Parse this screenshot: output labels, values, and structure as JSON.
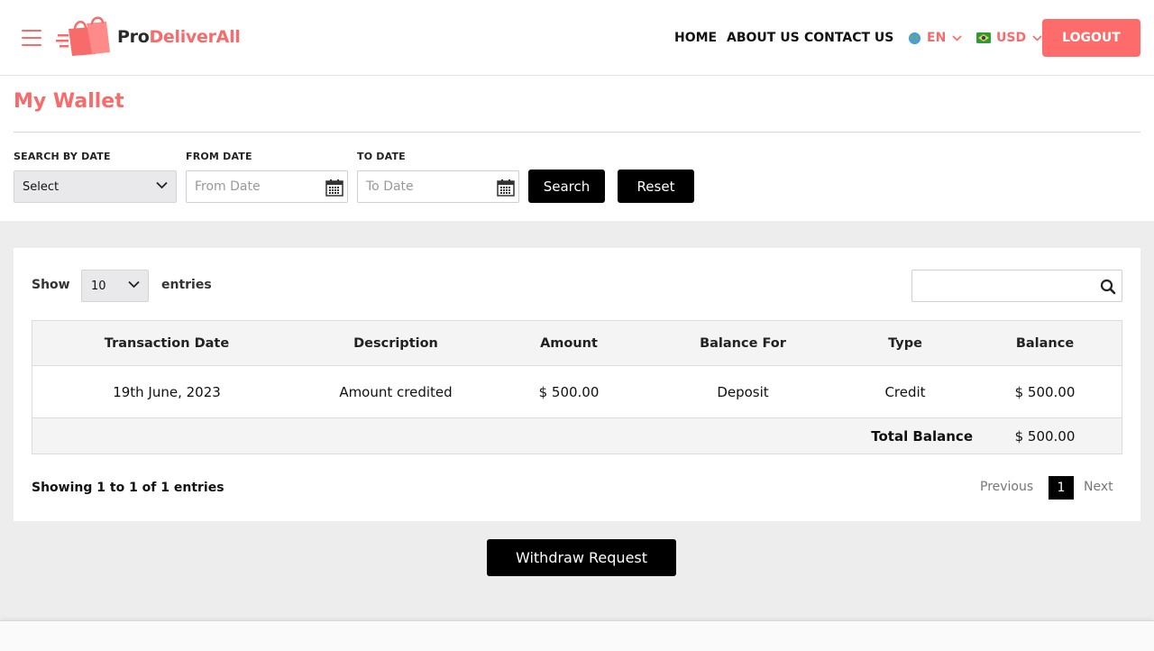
{
  "brand": {
    "part1": "Pro",
    "part2": "DeliverAll",
    "accent_color": "#f76b6b"
  },
  "nav": {
    "home": "HOME",
    "about": "ABOUT US",
    "contact": "CONTACT US",
    "language": "EN",
    "currency": "USD",
    "logout": "LOGOUT"
  },
  "page": {
    "title": "My Wallet"
  },
  "filters": {
    "search_by_date_label": "SEARCH BY DATE",
    "search_by_date_value": "Select",
    "from_date_label": "FROM DATE",
    "from_date_placeholder": "From Date",
    "to_date_label": "TO DATE",
    "to_date_placeholder": "To Date",
    "search_button": "Search",
    "reset_button": "Reset"
  },
  "table_controls": {
    "show_label": "Show",
    "entries_value": "10",
    "entries_label": "entries"
  },
  "table": {
    "headers": [
      "Transaction Date",
      "Description",
      "Amount",
      "Balance For",
      "Type",
      "Balance"
    ],
    "rows": [
      [
        "19th June, 2023",
        "Amount credited",
        "$ 500.00",
        "Deposit",
        "Credit",
        "$ 500.00"
      ]
    ],
    "total_label": "Total Balance",
    "total_value": "$ 500.00"
  },
  "pagination": {
    "info": "Showing 1 to 1 of 1 entries",
    "previous": "Previous",
    "current": "1",
    "next": "Next"
  },
  "actions": {
    "withdraw": "Withdraw Request"
  },
  "icons": [
    "hamburger-icon",
    "shopping-bag-logo-icon",
    "globe-icon",
    "flag-icon",
    "chevron-down-icon",
    "calendar-icon",
    "search-icon"
  ]
}
